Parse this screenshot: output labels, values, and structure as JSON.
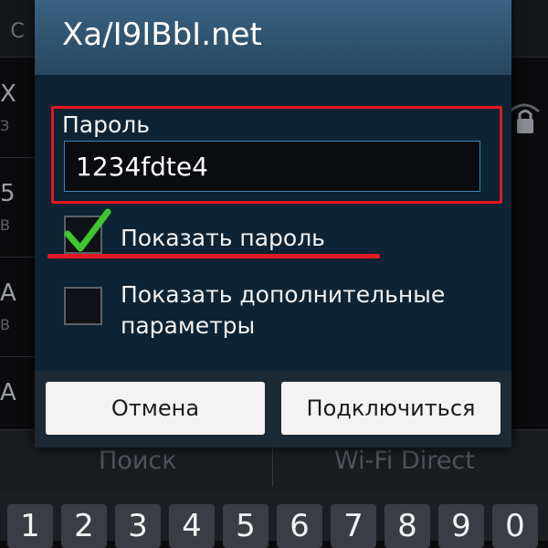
{
  "background": {
    "header_letter": "C",
    "rows": [
      {
        "l1": "X",
        "l2": "З"
      },
      {
        "l1": "5",
        "l2": "В"
      },
      {
        "l1": "A",
        "l2": "В"
      },
      {
        "l1": "A",
        "l2": ""
      }
    ],
    "bottom_tabs": {
      "search": "Поиск",
      "wifi_direct": "Wi-Fi Direct"
    }
  },
  "keyboard": {
    "keys": [
      "1",
      "2",
      "3",
      "4",
      "5",
      "6",
      "7",
      "8",
      "9",
      "0"
    ]
  },
  "dialog": {
    "title": "Xa/I9IBbI.net",
    "password_label": "Пароль",
    "password_value": "1234fdte4",
    "show_password": {
      "label": "Показать пароль",
      "checked": true
    },
    "show_advanced": {
      "label": "Показать дополнительные параметры",
      "checked": false
    },
    "cancel_button": "Отмена",
    "connect_button": "Подключиться"
  },
  "colors": {
    "annotation_red": "#e01a22",
    "check_green": "#3fc62f",
    "input_border": "#3c86b6",
    "title_bar": "#33597a"
  }
}
